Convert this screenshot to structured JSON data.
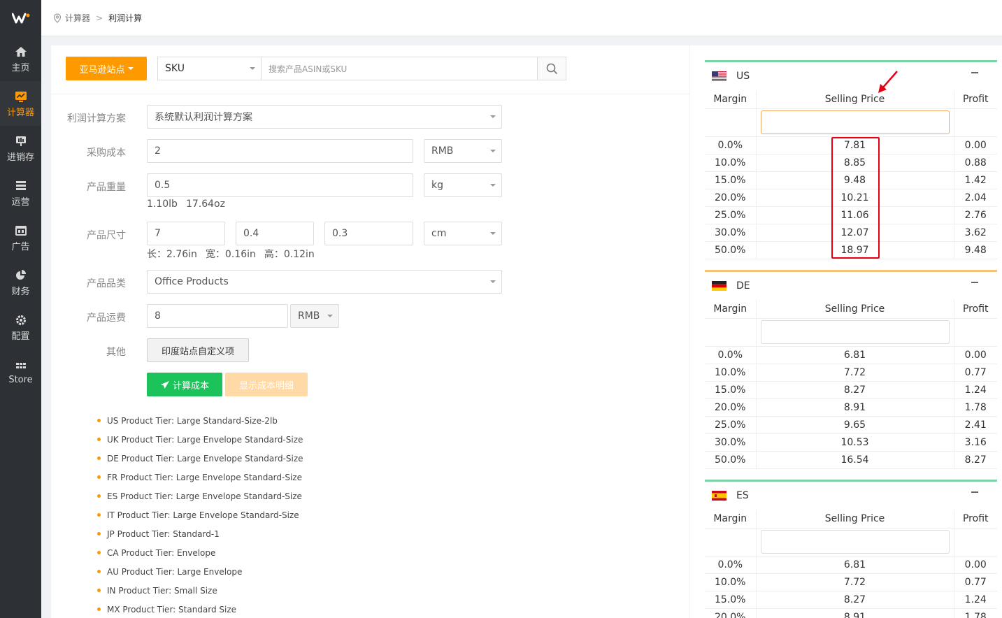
{
  "brand": {
    "logo_text": "W"
  },
  "sidebar": {
    "items": [
      {
        "label": "主页",
        "icon": "home-icon"
      },
      {
        "label": "计算器",
        "icon": "calculator-chart-icon",
        "active": true
      },
      {
        "label": "进销存",
        "icon": "inventory-icon"
      },
      {
        "label": "运营",
        "icon": "operations-icon"
      },
      {
        "label": "广告",
        "icon": "ad-icon"
      },
      {
        "label": "财务",
        "icon": "finance-pie-icon"
      },
      {
        "label": "配置",
        "icon": "gear-icon"
      },
      {
        "label": "Store",
        "icon": "grid-icon"
      }
    ]
  },
  "breadcrumb": {
    "root": "计算器",
    "separator": ">",
    "current": "利润计算"
  },
  "search": {
    "site_button": "亚马逊站点",
    "type_value": "SKU",
    "placeholder": "搜索产品ASIN或SKU"
  },
  "form": {
    "scheme_label": "利润计算方案",
    "scheme_value": "系统默认利润计算方案",
    "cost_label": "采购成本",
    "cost_value": "2",
    "cost_currency": "RMB",
    "weight_label": "产品重量",
    "weight_value": "0.5",
    "weight_unit": "kg",
    "weight_conv": [
      "1.10lb",
      "17.64oz"
    ],
    "size_label": "产品尺寸",
    "size_l": "7",
    "size_w": "0.4",
    "size_h": "0.3",
    "size_unit": "cm",
    "size_conv": [
      "长：2.76in",
      "宽：0.16in",
      "高：0.12in"
    ],
    "category_label": "产品品类",
    "category_value": "Office Products",
    "shipping_label": "产品运费",
    "shipping_value": "8",
    "shipping_currency": "RMB",
    "other_label": "其他",
    "india_button": "印度站点自定义项",
    "calc_button": "计算成本",
    "detail_button": "显示成本明细"
  },
  "tiers": [
    "US Product Tier: Large Standard-Size-2lb",
    "UK Product Tier: Large Envelope Standard-Size",
    "DE Product Tier: Large Envelope Standard-Size",
    "FR Product Tier: Large Envelope Standard-Size",
    "ES Product Tier: Large Envelope Standard-Size",
    "IT Product Tier: Large Envelope Standard-Size",
    "JP Product Tier: Standard-1",
    "CA Product Tier: Envelope",
    "AU Product Tier: Large Envelope",
    "IN Product Tier: Small Size",
    "MX Product Tier: Standard Size"
  ],
  "table_headers": {
    "margin": "Margin",
    "selling_price": "Selling Price",
    "profit": "Profit"
  },
  "countries": [
    {
      "code": "US",
      "accent": "#7dd3a8",
      "rows": [
        [
          "0.0%",
          "7.81",
          "0.00"
        ],
        [
          "10.0%",
          "8.85",
          "0.88"
        ],
        [
          "15.0%",
          "9.48",
          "1.42"
        ],
        [
          "20.0%",
          "10.21",
          "2.04"
        ],
        [
          "25.0%",
          "11.06",
          "2.76"
        ],
        [
          "30.0%",
          "12.07",
          "3.62"
        ],
        [
          "50.0%",
          "18.97",
          "9.48"
        ]
      ]
    },
    {
      "code": "DE",
      "accent": "#f5c27a",
      "rows": [
        [
          "0.0%",
          "6.81",
          "0.00"
        ],
        [
          "10.0%",
          "7.72",
          "0.77"
        ],
        [
          "15.0%",
          "8.27",
          "1.24"
        ],
        [
          "20.0%",
          "8.91",
          "1.78"
        ],
        [
          "25.0%",
          "9.65",
          "2.41"
        ],
        [
          "30.0%",
          "10.53",
          "3.16"
        ],
        [
          "50.0%",
          "16.54",
          "8.27"
        ]
      ]
    },
    {
      "code": "ES",
      "accent": "#7dd3a8",
      "rows": [
        [
          "0.0%",
          "6.81",
          "0.00"
        ],
        [
          "10.0%",
          "7.72",
          "0.77"
        ],
        [
          "15.0%",
          "8.27",
          "1.24"
        ],
        [
          "20.0%",
          "8.91",
          "1.78"
        ]
      ]
    }
  ]
}
